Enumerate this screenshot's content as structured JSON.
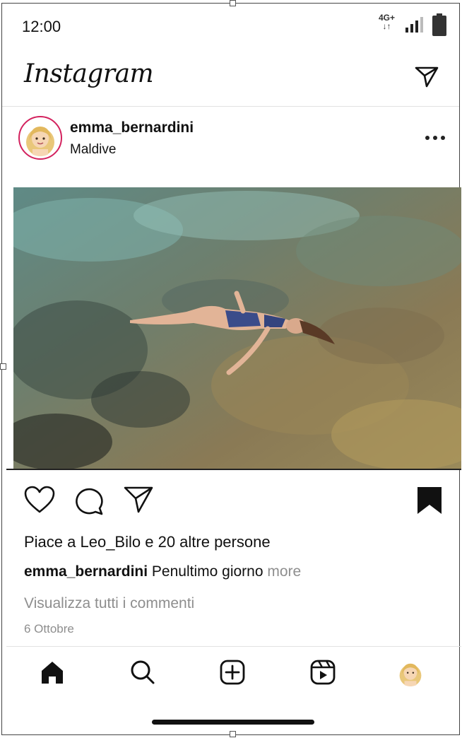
{
  "status_bar": {
    "time": "12:00",
    "network": "4G+",
    "network_arrows": "↓↑"
  },
  "app": {
    "logo_text": "Instagram",
    "icons": [
      "direct-send-icon"
    ]
  },
  "post": {
    "username": "emma_bernardini",
    "location": "Maldive",
    "image_alt": "Person floating in clear shallow sea water over rocks",
    "likes_text": "Piace a Leo_Bilo e 20 altre persone",
    "caption_user": "emma_bernardini",
    "caption_text": "Penultimo giorno",
    "caption_more": "more",
    "view_comments": "Visualizza tutti i commenti",
    "date": "6 Ottobre",
    "saved": true
  },
  "tab_bar": {
    "items": [
      "home-icon",
      "search-icon",
      "new-post-icon",
      "reels-icon",
      "profile-avatar"
    ]
  },
  "colors": {
    "avatar_ring": "#d3225e",
    "muted_text": "#8e8e8e"
  }
}
